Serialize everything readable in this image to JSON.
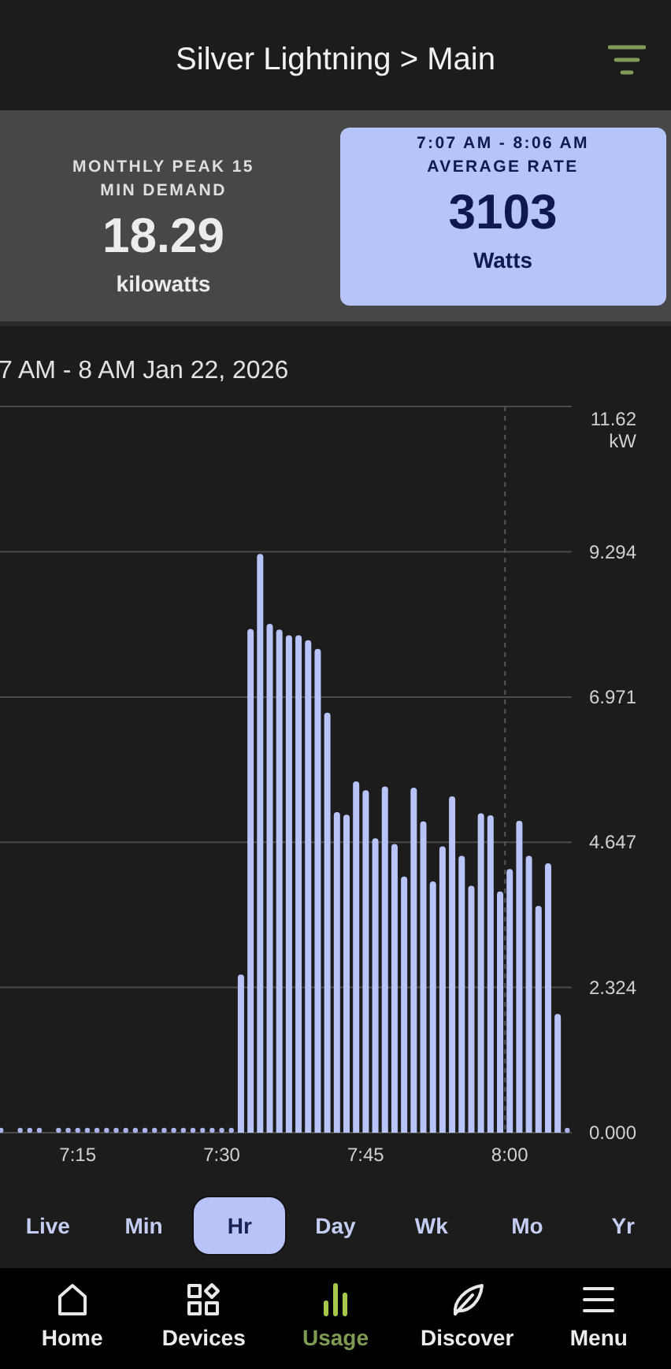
{
  "header": {
    "title": "Silver Lightning > Main"
  },
  "cards": [
    {
      "label": "MONTHLY PEAK 15 MIN DEMAND",
      "value": "18.29",
      "unit": "kilowatts",
      "selected": false
    },
    {
      "subtitle": "7:07 AM - 8:06 AM",
      "label": "AVERAGE RATE",
      "value": "3103",
      "unit": "Watts",
      "selected": true
    }
  ],
  "chart": {
    "title": "7 AM - 8 AM Jan 22, 2026",
    "chart_data": {
      "type": "bar",
      "ylabel": "kW",
      "categories": [
        null,
        null,
        null,
        null,
        null,
        null,
        null,
        null,
        "7:15",
        null,
        null,
        null,
        null,
        null,
        null,
        null,
        null,
        null,
        null,
        null,
        null,
        null,
        null,
        "7:30",
        null,
        null,
        null,
        null,
        null,
        null,
        null,
        null,
        null,
        null,
        null,
        null,
        null,
        null,
        "7:45",
        null,
        null,
        null,
        null,
        null,
        null,
        null,
        null,
        null,
        null,
        null,
        null,
        null,
        null,
        "8:00",
        null,
        null,
        null,
        null,
        null,
        null
      ],
      "series": [
        {
          "color": "#b8c4f8",
          "values": [
            0,
            null,
            0,
            0,
            0,
            null,
            0,
            0,
            0,
            0,
            0,
            0,
            0,
            0,
            0,
            0,
            0,
            0,
            0,
            0,
            0,
            0,
            0,
            0,
            0,
            2.53,
            8.06,
            9.26,
            8.14,
            8.05,
            7.96,
            7.96,
            7.88,
            7.74,
            6.72,
            5.13,
            5.09,
            5.62,
            5.48,
            4.71,
            5.54,
            4.62,
            4.1,
            5.52,
            4.98,
            4.02,
            4.58,
            5.38,
            4.43,
            3.95,
            5.11,
            5.08,
            3.86,
            4.22,
            4.99,
            4.43,
            3.63,
            4.31,
            1.9,
            0
          ]
        }
      ],
      "ylim": [
        0,
        11.62
      ],
      "yticks": [
        {
          "value": 0,
          "label": "0.000"
        },
        {
          "value": 2.324,
          "label": "2.324"
        },
        {
          "value": 4.647,
          "label": "4.647"
        },
        {
          "value": 6.971,
          "label": "6.971"
        },
        {
          "value": 9.294,
          "label": "9.294"
        },
        {
          "value": 11.62,
          "label": "11.62"
        }
      ],
      "grid": true
    }
  },
  "periods": [
    {
      "label": "Live",
      "selected": false
    },
    {
      "label": "Min",
      "selected": false
    },
    {
      "label": "Hr",
      "selected": true
    },
    {
      "label": "Day",
      "selected": false
    },
    {
      "label": "Wk",
      "selected": false
    },
    {
      "label": "Mo",
      "selected": false
    },
    {
      "label": "Yr",
      "selected": false
    }
  ],
  "nav": [
    {
      "kind": "home",
      "label": "Home",
      "selected": false
    },
    {
      "kind": "devices",
      "label": "Devices",
      "selected": false
    },
    {
      "kind": "usage",
      "label": "Usage",
      "selected": true
    },
    {
      "kind": "discover",
      "label": "Discover",
      "selected": false
    },
    {
      "kind": "menu",
      "label": "Menu",
      "selected": false
    }
  ]
}
